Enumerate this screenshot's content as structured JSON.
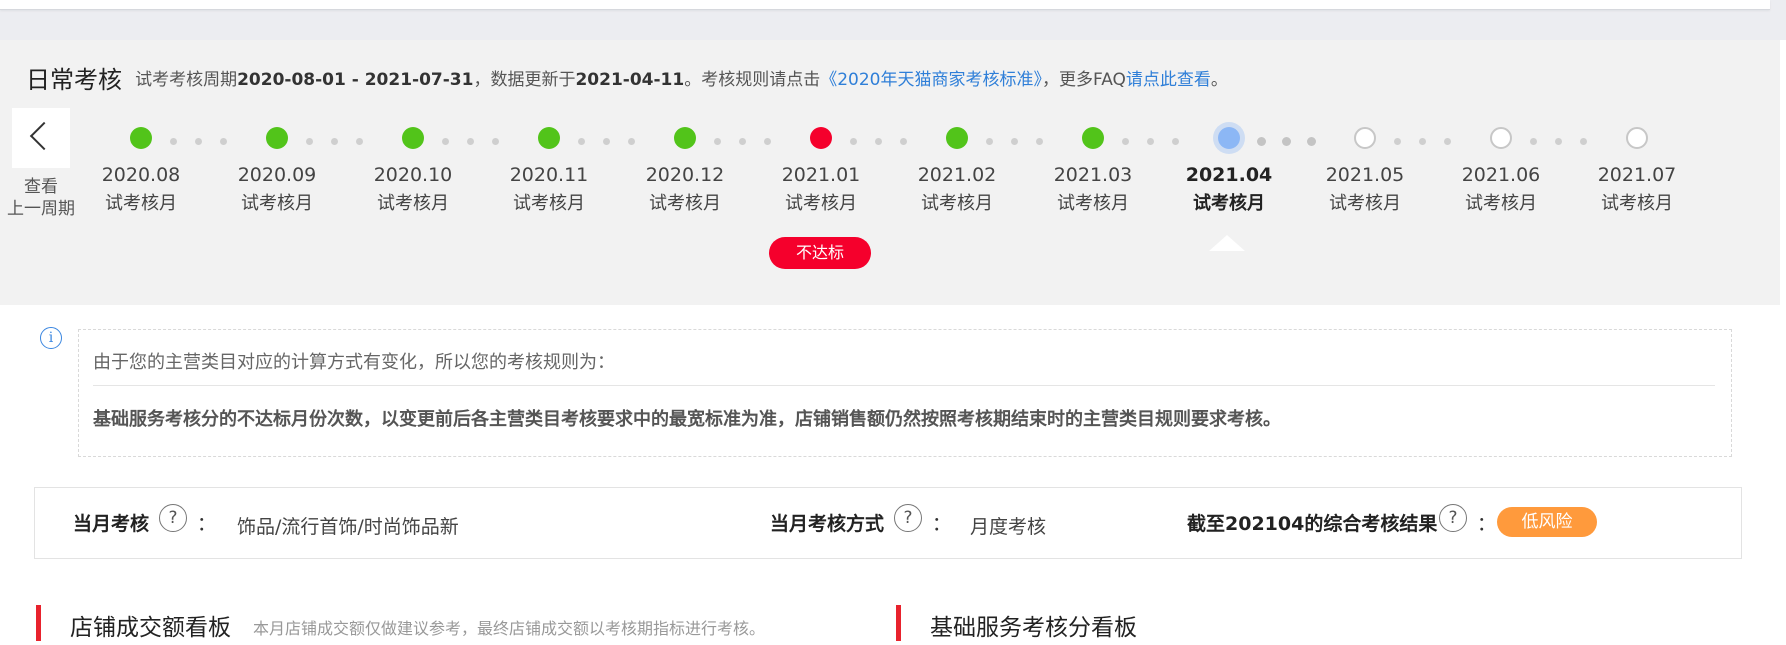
{
  "header": {
    "title": "日常考核",
    "desc_prefix": "试考考核周期",
    "period": "2020-08-01 - 2021-07-31",
    "desc_mid": "，数据更新于",
    "update_date": "2021-04-11",
    "desc_rule": "。考核规则请点击",
    "rule_link": "《2020年天猫商家考核标准》",
    "desc_more": "，更多FAQ",
    "faq_link": "请点此查看",
    "desc_end": "。"
  },
  "prev_period": {
    "line1": "查看",
    "line2": "上一周期"
  },
  "timeline": {
    "months": [
      {
        "label": "2020.08",
        "sub": "试考核月",
        "status": "pass"
      },
      {
        "label": "2020.09",
        "sub": "试考核月",
        "status": "pass"
      },
      {
        "label": "2020.10",
        "sub": "试考核月",
        "status": "pass"
      },
      {
        "label": "2020.11",
        "sub": "试考核月",
        "status": "pass"
      },
      {
        "label": "2020.12",
        "sub": "试考核月",
        "status": "pass"
      },
      {
        "label": "2021.01",
        "sub": "试考核月",
        "status": "fail"
      },
      {
        "label": "2021.02",
        "sub": "试考核月",
        "status": "pass"
      },
      {
        "label": "2021.03",
        "sub": "试考核月",
        "status": "pass"
      },
      {
        "label": "2021.04",
        "sub": "试考核月",
        "status": "current"
      },
      {
        "label": "2021.05",
        "sub": "试考核月",
        "status": "future"
      },
      {
        "label": "2021.06",
        "sub": "试考核月",
        "status": "future"
      },
      {
        "label": "2021.07",
        "sub": "试考核月",
        "status": "future"
      }
    ],
    "fail_badge": "不达标"
  },
  "rule_notice": {
    "line1": "由于您的主营类目对应的计算方式有变化，所以您的考核规则为：",
    "line2": "基础服务考核分的不达标月份次数，以变更前后各主营类目考核要求中的最宽标准为准，店铺销售额仍然按照考核期结束时的主营类目规则要求考核。"
  },
  "status_bar": {
    "category_label": "当月考核",
    "category_value": "饰品/流行首饰/时尚饰品新",
    "method_label": "当月考核方式",
    "method_value": "月度考核",
    "result_label": "截至202104的综合考核结果",
    "result_value": "低风险",
    "help_glyph": "?",
    "colon": "："
  },
  "sections": {
    "left_title": "店铺成交额看板",
    "left_note": "本月店铺成交额仅做建议参考，最终店铺成交额以考核期指标进行考核。",
    "right_title": "基础服务考核分看板"
  },
  "colors": {
    "pass": "#52c41a",
    "fail": "#f5002c",
    "current": "#8cb7f5",
    "risk": "#ff9a3c",
    "link": "#2f7fd8",
    "accent": "#e8222d"
  }
}
